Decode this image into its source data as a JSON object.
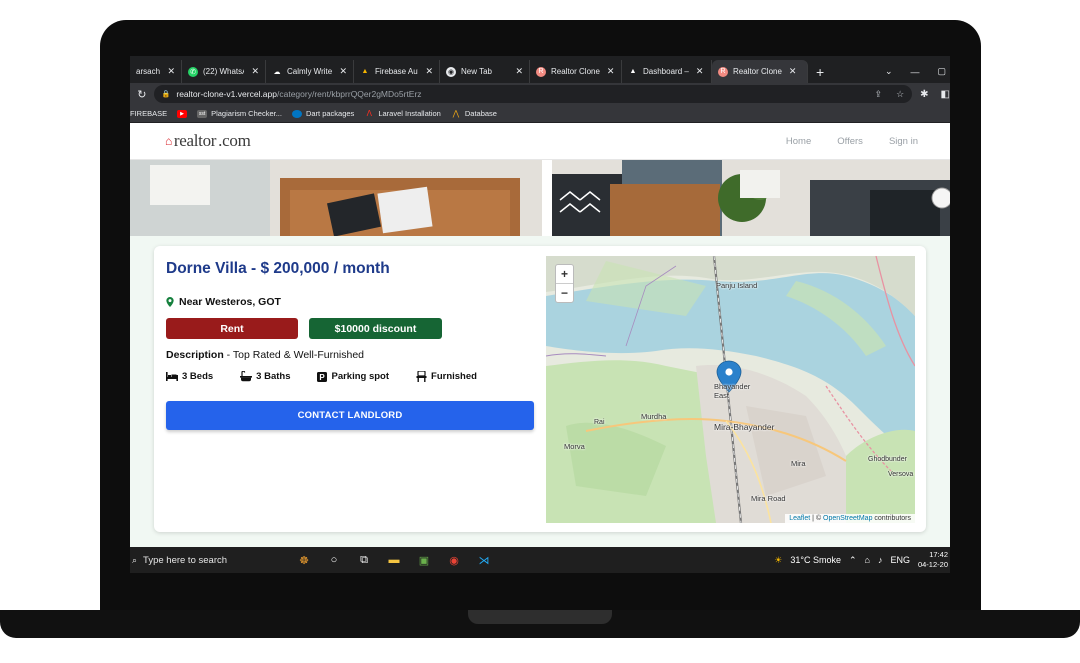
{
  "browser": {
    "tabs": [
      {
        "label": "arsachin",
        "icon": "generic-tab-icon",
        "active": false
      },
      {
        "label": "(22) WhatsAp",
        "icon": "whatsapp-icon",
        "active": false
      },
      {
        "label": "Calmly Writer",
        "icon": "calmly-writer-icon",
        "active": false
      },
      {
        "label": "Firebase Auth",
        "icon": "firebase-icon",
        "active": false
      },
      {
        "label": "New Tab",
        "icon": "chrome-icon",
        "active": false
      },
      {
        "label": "Realtor Clone",
        "icon": "realtor-icon",
        "active": false
      },
      {
        "label": "Dashboard –",
        "icon": "vercel-icon",
        "active": false
      },
      {
        "label": "Realtor Clone",
        "icon": "realtor-icon",
        "active": true
      }
    ],
    "new_tab": "+",
    "url_host": "realtor-clone-v1.vercel.app",
    "url_path": "/category/rent/kbprrQQer2gMDo5rtErz",
    "bookmarks": [
      {
        "label": "FIREBASE",
        "icon": "firebase-icon",
        "color": "#f4b400"
      },
      {
        "label": "",
        "icon": "youtube-icon",
        "color": "#ff0000"
      },
      {
        "label": "Plagiarism Checker...",
        "icon": "sst-icon",
        "color": "#555555"
      },
      {
        "label": "Dart packages",
        "icon": "dart-icon",
        "color": "#0175c2"
      },
      {
        "label": "Laravel Installation",
        "icon": "laravel-icon",
        "color": "#ff2d20"
      },
      {
        "label": "Database",
        "icon": "database-icon",
        "color": "#e8a317"
      }
    ]
  },
  "site": {
    "logo_prefix": "realtor",
    "logo_suffix": ".com",
    "nav": [
      "Home",
      "Offers",
      "Sign in"
    ]
  },
  "listing": {
    "title": "Dorne Villa - $ 200,000 / month",
    "location": "Near Westeros, GOT",
    "type_badge": "Rent",
    "discount_badge": "$10000 discount",
    "description_label": "Description",
    "description_text": " - Top Rated & Well-Furnished",
    "features": [
      {
        "icon": "bed-icon",
        "label": "3 Beds"
      },
      {
        "icon": "bath-icon",
        "label": "3 Baths"
      },
      {
        "icon": "parking-icon",
        "label": "Parking spot"
      },
      {
        "icon": "chair-icon",
        "label": "Furnished"
      }
    ],
    "contact_label": "CONTACT LANDLORD"
  },
  "map": {
    "zoom_in": "+",
    "zoom_out": "−",
    "labels": [
      "Panju Island",
      "Bhayander East",
      "Mira-Bhayander",
      "Murdha",
      "Morva",
      "Mira",
      "Mira Road",
      "Ghodbunder",
      "Versova",
      "Rai"
    ],
    "attribution_leaflet": "Leaflet",
    "attribution_sep": " | © ",
    "attribution_osm": "OpenStreetMap",
    "attribution_tail": " contributors",
    "colors": {
      "water": "#aad3df",
      "land": "#e7eadf",
      "green": "#c8e3b4",
      "urban": "#e0dcd6",
      "marker": "#2a81cb"
    }
  },
  "taskbar": {
    "search_placeholder": "Type here to search",
    "weather": "31°C  Smoke",
    "lang": "ENG",
    "time": "17:42",
    "date": "04-12-20"
  }
}
